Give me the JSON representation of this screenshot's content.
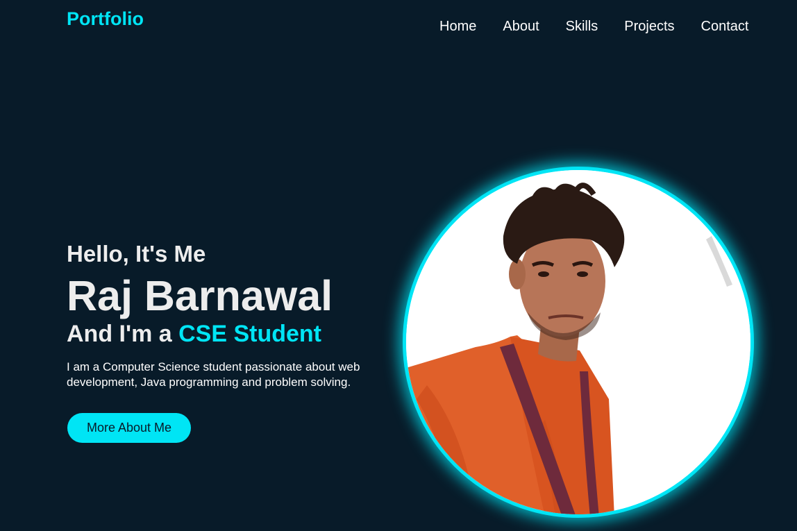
{
  "header": {
    "logo": "Portfolio",
    "nav": [
      "Home",
      "About",
      "Skills",
      "Projects",
      "Contact"
    ]
  },
  "hero": {
    "greeting": "Hello, It's Me",
    "name": "Raj Barnawal",
    "role_prefix": "And I'm a ",
    "role_highlight": "CSE Student",
    "description": "I am a Computer Science student passionate about web development, Java programming and problem solving.",
    "button_label": "More About Me"
  },
  "colors": {
    "background": "#081b29",
    "accent": "#00e5f5",
    "text": "#ededed"
  }
}
